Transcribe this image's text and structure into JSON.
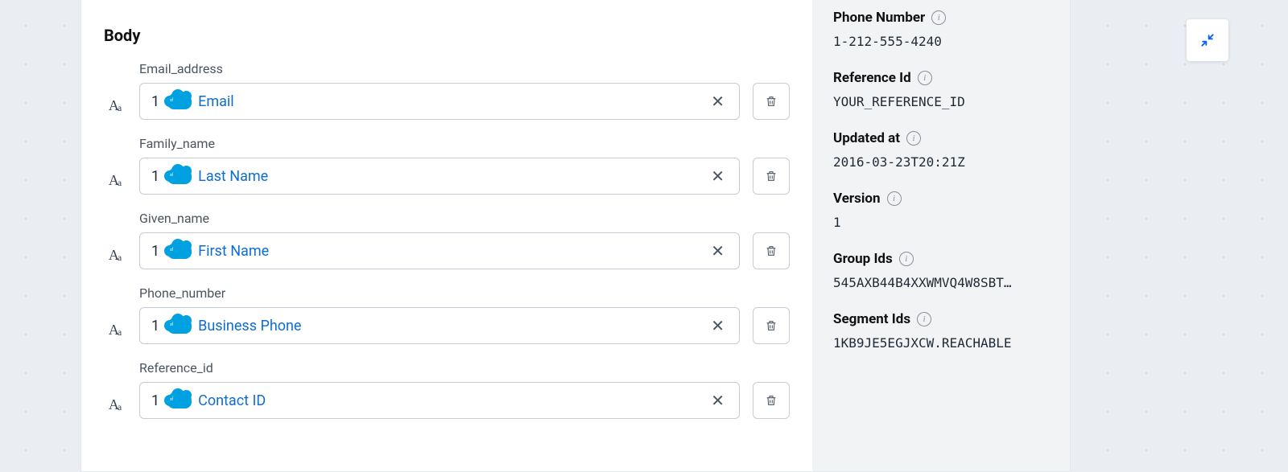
{
  "body": {
    "section_title": "Body",
    "fields": [
      {
        "label": "Email_address",
        "index": "1",
        "value": "Email"
      },
      {
        "label": "Family_name",
        "index": "1",
        "value": "Last Name"
      },
      {
        "label": "Given_name",
        "index": "1",
        "value": "First Name"
      },
      {
        "label": "Phone_number",
        "index": "1",
        "value": "Business Phone"
      },
      {
        "label": "Reference_id",
        "index": "1",
        "value": "Contact ID"
      }
    ]
  },
  "meta": [
    {
      "label": "Phone Number",
      "value": "1-212-555-4240"
    },
    {
      "label": "Reference Id",
      "value": "YOUR_REFERENCE_ID"
    },
    {
      "label": "Updated at",
      "value": "2016-03-23T20:21Z"
    },
    {
      "label": "Version",
      "value": "1"
    },
    {
      "label": "Group Ids",
      "value": "545AXB44B4XXWMVQ4W8SBT…"
    },
    {
      "label": "Segment Ids",
      "value": "1KB9JE5EGJXCW.REACHABLE"
    }
  ],
  "icons": {
    "info_glyph": "i"
  }
}
